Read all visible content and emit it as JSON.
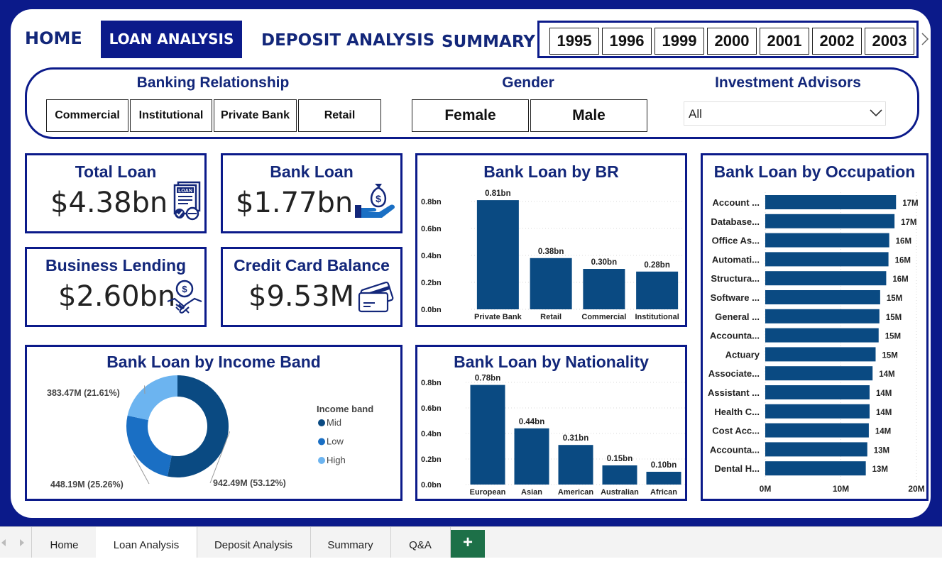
{
  "nav": {
    "home": "HOME",
    "loan_analysis": "LOAN ANALYSIS",
    "deposit_analysis": "DEPOSIT ANALYSIS",
    "summary": "SUMMARY"
  },
  "years": [
    "1995",
    "1996",
    "1999",
    "2000",
    "2001",
    "2002",
    "2003"
  ],
  "filters": {
    "banking_relationship": {
      "title": "Banking Relationship",
      "options": [
        "Commercial",
        "Institutional",
        "Private Bank",
        "Retail"
      ]
    },
    "gender": {
      "title": "Gender",
      "options": [
        "Female",
        "Male"
      ]
    },
    "investment_advisors": {
      "title": "Investment Advisors",
      "value": "All"
    }
  },
  "kpis": {
    "total_loan": {
      "title": "Total Loan",
      "value": "$4.38bn",
      "icon": "loan-document-icon"
    },
    "bank_loan": {
      "title": "Bank Loan",
      "value": "$1.77bn",
      "icon": "money-bag-hand-icon"
    },
    "business_lending": {
      "title": "Business Lending",
      "value": "$2.60bn",
      "icon": "handshake-coin-icon"
    },
    "credit_card_balance": {
      "title": "Credit Card Balance",
      "value": "$9.53M",
      "icon": "credit-card-icon"
    }
  },
  "colors": {
    "brand": "#0b1a8a",
    "bar": "#0a4a82",
    "mid": "#0a4a82",
    "low": "#1a6fc4",
    "high": "#6cb4f0"
  },
  "chart_data": [
    {
      "id": "br",
      "type": "bar",
      "title": "Bank Loan by BR",
      "categories": [
        "Private Bank",
        "Retail",
        "Commercial",
        "Institutional"
      ],
      "values": [
        0.81,
        0.38,
        0.3,
        0.28
      ],
      "labels": [
        "0.81bn",
        "0.38bn",
        "0.30bn",
        "0.28bn"
      ],
      "yticks": [
        "0.8bn",
        "0.6bn",
        "0.4bn",
        "0.2bn",
        "0.0bn"
      ],
      "ylim": [
        0,
        0.85
      ]
    },
    {
      "id": "income",
      "type": "pie",
      "title": "Bank Loan by Income Band",
      "legend_title": "Income band",
      "categories": [
        "Mid",
        "Low",
        "High"
      ],
      "values": [
        942.49,
        448.19,
        383.47
      ],
      "labels": [
        "942.49M (53.12%)",
        "448.19M (25.26%)",
        "383.47M (21.61%)"
      ]
    },
    {
      "id": "nationality",
      "type": "bar",
      "title": "Bank Loan by Nationality",
      "categories": [
        "European",
        "Asian",
        "American",
        "Australian",
        "African"
      ],
      "values": [
        0.78,
        0.44,
        0.31,
        0.15,
        0.1
      ],
      "labels": [
        "0.78bn",
        "0.44bn",
        "0.31bn",
        "0.15bn",
        "0.10bn"
      ],
      "yticks": [
        "0.8bn",
        "0.6bn",
        "0.4bn",
        "0.2bn",
        "0.0bn"
      ],
      "ylim": [
        0,
        0.8
      ]
    },
    {
      "id": "occupation",
      "type": "bar",
      "orientation": "horizontal",
      "title": "Bank Loan by Occupation",
      "categories": [
        "Account ...",
        "Database...",
        "Office As...",
        "Automati...",
        "Structura...",
        "Software ...",
        "General ...",
        "Accounta...",
        "Actuary",
        "Associate...",
        "Assistant ...",
        "Health C...",
        "Cost Acc...",
        "Accounta...",
        "Dental H..."
      ],
      "values": [
        17.3,
        17.1,
        16.4,
        16.3,
        16.0,
        15.2,
        15.1,
        15.0,
        14.6,
        14.2,
        13.8,
        13.8,
        13.7,
        13.5,
        13.3
      ],
      "labels": [
        "17M",
        "17M",
        "16M",
        "16M",
        "16M",
        "15M",
        "15M",
        "15M",
        "15M",
        "14M",
        "14M",
        "14M",
        "14M",
        "13M",
        "13M"
      ],
      "xticks": [
        "0M",
        "10M",
        "20M"
      ],
      "xlim": [
        0,
        20
      ]
    }
  ],
  "sheet_tabs": [
    "Home",
    "Loan Analysis",
    "Deposit Analysis",
    "Summary",
    "Q&A"
  ],
  "add_sheet": "+"
}
